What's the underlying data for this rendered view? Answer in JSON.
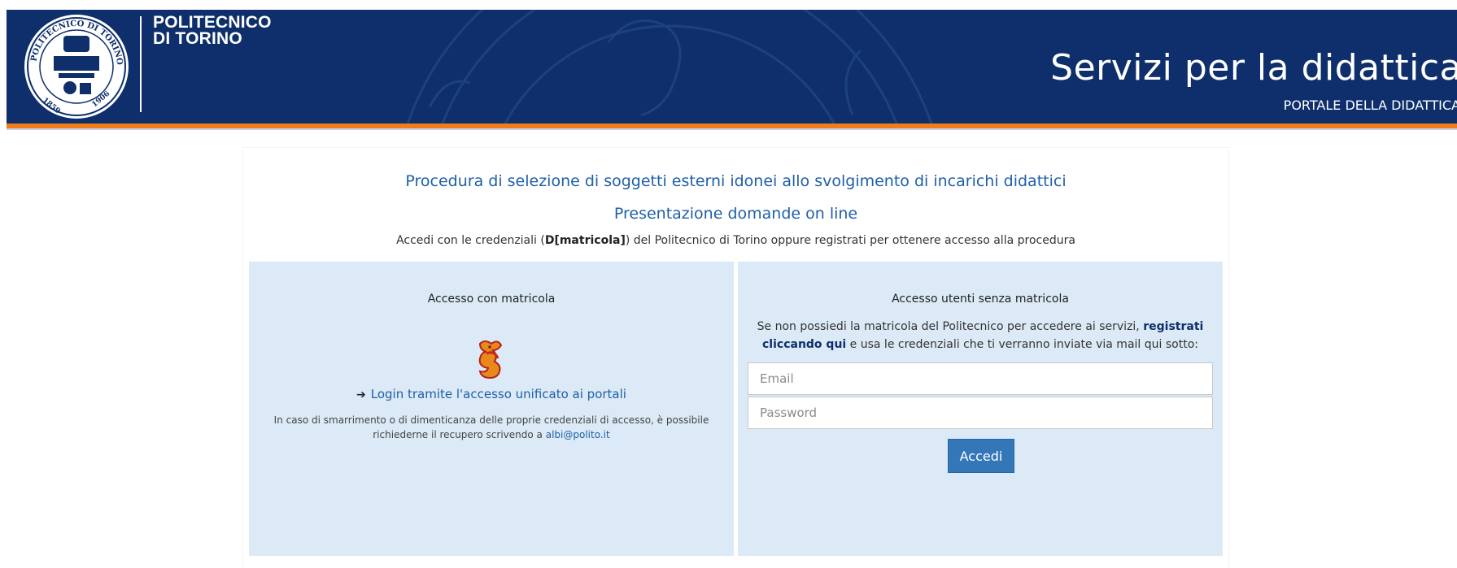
{
  "header": {
    "brand_line1": "POLITECNICO",
    "brand_line2": "DI TORINO",
    "title": "Servizi per la didattica",
    "subtitle": "PORTALE DELLA DIDATTICA",
    "seal_text_top": "POLITECNICO DI TORINO",
    "seal_year_left": "1859",
    "seal_year_right": "1906",
    "colors": {
      "navy": "#0e2f6b",
      "orange": "#f07d17"
    }
  },
  "main": {
    "title": "Procedura di selezione di soggetti esterni idonei allo svolgimento di incarichi didattici",
    "subtitle": "Presentazione domande on line",
    "intro_prefix": "Accedi con le credenziali (",
    "intro_bold": "D[matricola]",
    "intro_suffix": ") del Politecnico di Torino oppure registrati per ottenere accesso alla procedura"
  },
  "left_panel": {
    "heading": "Accesso con matricola",
    "logo_icon": "griffin-logo-icon",
    "login_link": "Login tramite l'accesso unificato ai portali",
    "help_text": "In caso di smarrimento o di dimenticanza delle proprie credenziali di accesso, è possibile richiederne il recupero scrivendo a",
    "help_email": "albi@polito.it"
  },
  "right_panel": {
    "heading": "Accesso utenti senza matricola",
    "reg_text_prefix": "Se non possiedi la matricola del Politecnico per accedere ai servizi,",
    "reg_link": "registrati cliccando qui",
    "reg_text_suffix": "e usa le credenziali che ti verranno inviate via mail qui sotto:",
    "email_placeholder": "Email",
    "password_placeholder": "Password",
    "submit_label": "Accedi"
  }
}
